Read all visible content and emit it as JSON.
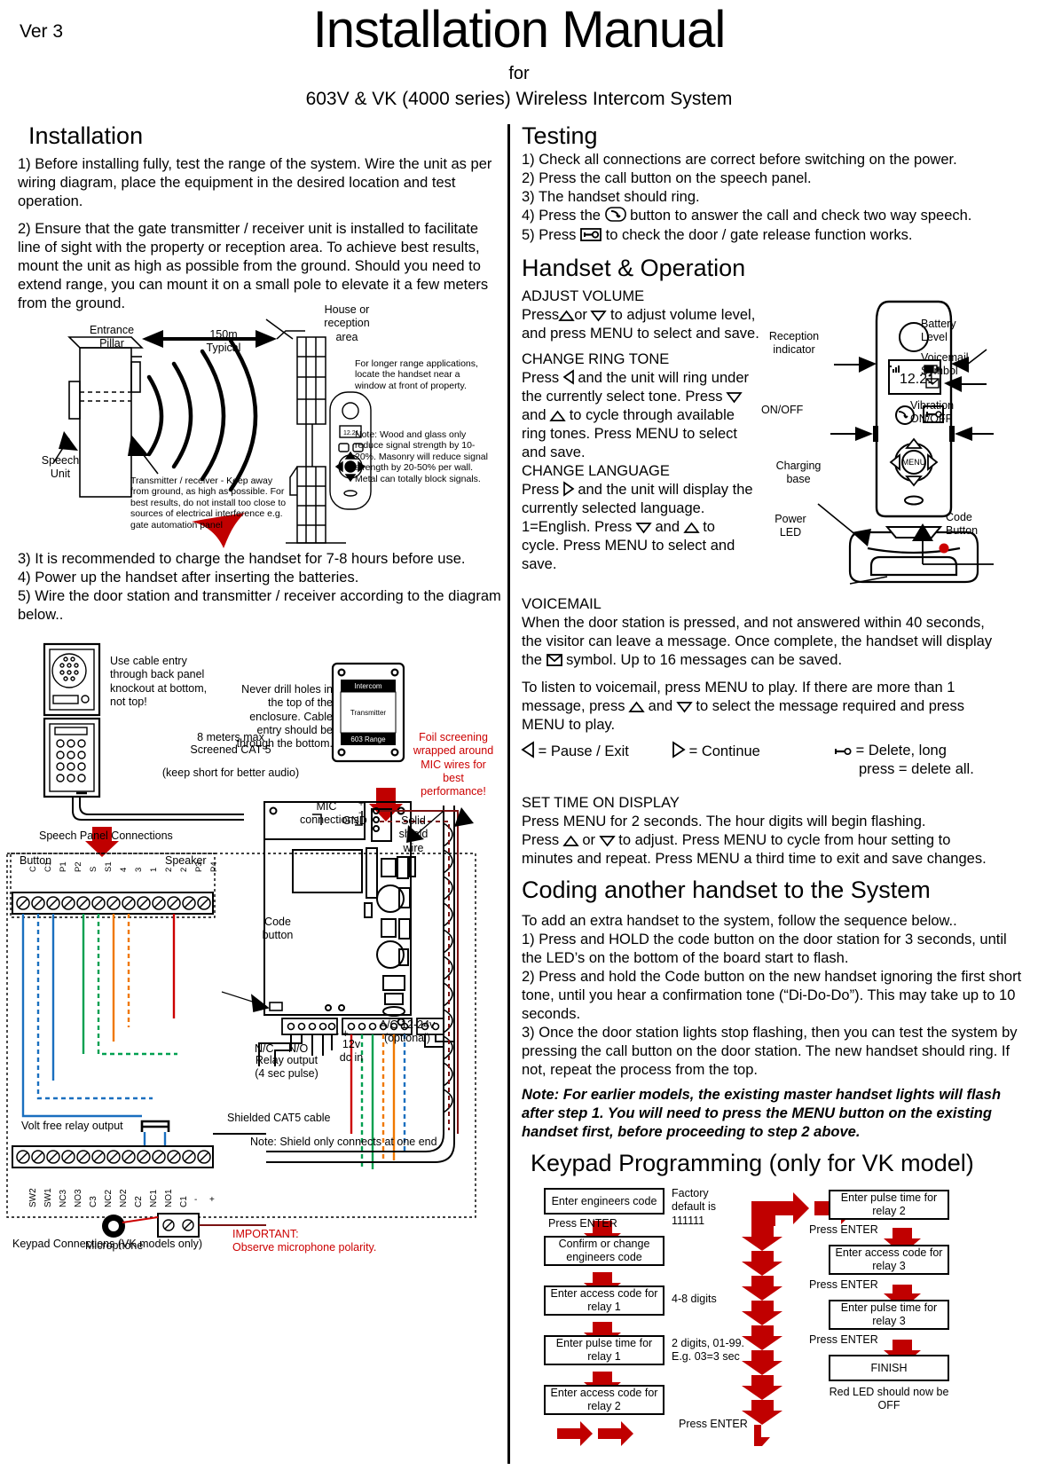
{
  "header": {
    "version": "Ver 3",
    "title": "Installation Manual",
    "for": "for",
    "subtitle": "603V & VK (4000 series) Wireless Intercom System"
  },
  "left": {
    "heading": "Installation",
    "step1": "1) Before installing fully, test the range of the system. Wire the unit as per wiring diagram, place the equipment in the desired location and test operation.",
    "step2": "2) Ensure that the gate transmitter / receiver unit is installed to facilitate line of sight with the property or reception area. To achieve best results, mount the unit as high as possible from the ground. Should you need to extend range, you can mount it on a small pole to elevate it a few meters from the ground.",
    "step3": "3) It is recommended to charge the handset for 7-8 hours before use.",
    "step4": "4) Power up the handset after inserting the batteries.",
    "step5": "5) Wire the door station and transmitter / receiver according to the diagram below..",
    "range_diagram": {
      "distance": "150m",
      "distance_sub": "Typical",
      "entrance_pillar": "Entrance\nPillar",
      "speech_unit": "Speech\nUnit",
      "house": "House or\nreception\narea",
      "transmitter_note": "Transmitter / receiver - Keep away from ground, as high as possible. For best results, do not install too close to sources of electrical interference e.g. gate automation panel",
      "longer_range": "For longer range applications, locate the handset near a window at front of property.",
      "material_note": "Note: Wood and glass only reduce signal strength by 10-20%. Masonry will reduce signal strength by 20-50% per wall. Metal can totally block signals."
    },
    "wiring": {
      "cable_entry": "Use cable entry through back panel knockout at bottom, not top!",
      "never_drill": "Never drill holes in the top of the enclosure. Cable entry should be through the bottom.",
      "cat5_max": "8 meters max",
      "cat5_type": "Screened CAT 5",
      "keep_short": "(keep short for better audio)",
      "foil_note": "Foil screening wrapped around MIC wires for best performance!",
      "enclosure_top": "Intercom",
      "enclosure_mid": "Transmitter",
      "enclosure_bottom": "603 Range",
      "mic_connections": "MIC\nconnections",
      "mic_plus": "+",
      "mic_minus": "-",
      "mic_gnd": "GND",
      "solid_shield": "Solid\nshield\nwire",
      "code_button": "Code\nbutton",
      "nc_label": "N/C",
      "no_label": "N/O",
      "relay_output": "Relay output\n(4 sec pulse)",
      "dc_in": "12v\ndc in",
      "dc_signs": "- +",
      "ac_optional": "A/C 12-24v\n(optional)",
      "shielded_cat5": "Shielded CAT5 cable",
      "shield_note": "Note: Shield only connects at one end",
      "speech_panel_connections": "Speech Panel Connections",
      "button_label": "Button",
      "speaker_label": "Speaker",
      "top_terminals": [
        "C",
        "C1",
        "P1",
        "P2",
        "S",
        "S1",
        "4",
        "3",
        "1",
        "2",
        "2",
        "P3",
        "P4"
      ],
      "volt_free": "Volt free relay output",
      "bottom_terminals": [
        "SW2",
        "SW1",
        "NC3",
        "NO3",
        "C3",
        "NC2",
        "NO2",
        "C2",
        "NC1",
        "NO1",
        "C1",
        "-",
        "+"
      ],
      "keypad_connections": "Keypad Connections (VK models only)",
      "microphone": "Microphone",
      "important": "IMPORTANT:\nObserve microphone polarity."
    }
  },
  "right": {
    "testing": {
      "heading": "Testing",
      "steps": [
        "1) Check all connections are correct before switching on the power.",
        "2) Press the call button on the speech panel.",
        "3) The handset should ring.",
        "4) Press the",
        "5) Press"
      ],
      "step4_rest": "button to answer the call and check two way speech.",
      "step5_rest": "to check the door / gate release function works."
    },
    "handset": {
      "heading": "Handset & Operation",
      "adjust_volume_title": "ADJUST VOLUME",
      "adjust_volume_a": "Press",
      "adjust_volume_b": "or",
      "adjust_volume_c": "to adjust volume level,",
      "adjust_volume_d": "and press MENU to select and save.",
      "ring_tone_title": "CHANGE RING TONE",
      "ring_tone_a": "Press",
      "ring_tone_b": "and the unit will ring under",
      "ring_tone_c": "the currently select tone. Press",
      "ring_tone_d": "and",
      "ring_tone_e": "to cycle through available",
      "ring_tone_f": "ring tones. Press MENU to select",
      "ring_tone_g": "and save.",
      "language_title": "CHANGE LANGUAGE",
      "language_a": "Press",
      "language_b": "and the unit will display the",
      "language_c": "currently selected language.",
      "language_d": "1=English. Press",
      "language_e": "and",
      "language_f": "to",
      "language_g": "cycle. Press MENU to select and",
      "language_h": "save.",
      "diagram": {
        "reception_indicator": "Reception\nindicator",
        "battery_level": "Battery\nLevel",
        "voicemail_symbol": "Voicemail\nSymbol",
        "on_off": "ON/OFF",
        "vibration": "Vibration\nON/OFF",
        "charging_base": "Charging\nbase",
        "power_led": "Power\nLED",
        "code_button": "Code\nButton",
        "screen_time": "12.21",
        "menu_label": "MENU"
      }
    },
    "voicemail": {
      "title": "VOICEMAIL",
      "p1a": "When the door station is pressed, and not answered within 40 seconds,",
      "p1b": "the visitor can leave a message. Once complete, the handset will display",
      "p1c_pre": "the",
      "p1c_post": "symbol. Up to 16 messages can be saved.",
      "p2a": "To listen to voicemail, press MENU to play. If there are more than 1",
      "p2b_pre": "message, press",
      "p2b_mid": "and",
      "p2b_post": "to select the message required and press",
      "p2c": "MENU to play.",
      "legend_pause": "= Pause / Exit",
      "legend_continue": "= Continue",
      "legend_delete": "= Delete, long",
      "legend_delete2": "press = delete all."
    },
    "settime": {
      "title": "SET TIME ON DISPLAY",
      "l1": "Press MENU for 2 seconds. The hour digits will begin flashing.",
      "l2a": "Press",
      "l2b": "or",
      "l2c": "to adjust. Press MENU to cycle from hour setting to",
      "l3": "minutes and repeat. Press MENU a third time to exit and save changes."
    },
    "coding": {
      "heading": "Coding another handset to the System",
      "intro": "To add an extra handset to the system, follow the sequence below..",
      "step1": "1) Press and HOLD the code button on the door station for 3 seconds, until the LED’s on the bottom of the board start to flash.",
      "step2": "2) Press and hold the Code button on the new handset ignoring the first short tone, until you hear a confirmation tone (“Di-Do-Do”). This may take up to 10 seconds.",
      "step3": "3) Once the door station lights stop flashing, then you can test the system by pressing the call button on the door station. The new handset should ring. If not, repeat the process from the top.",
      "note": "Note: For earlier models, the existing master handset lights will flash after step 1. You will need to press the MENU button on the existing handset first, before proceeding to step 2 above."
    },
    "keypad": {
      "heading": "Keypad Programming (only for VK model)",
      "left_boxes": [
        "Enter engineers code",
        "Confirm or change engineers code",
        "Enter access code for relay 1",
        "Enter pulse time for relay 1",
        "Enter access code for relay 2"
      ],
      "right_boxes": [
        "Enter pulse time for relay 2",
        "Enter access code for relay 3",
        "Enter pulse time for relay 3",
        "FINISH"
      ],
      "annotation_factory": "Factory default is 111111",
      "annotation_digits": "4-8 digits",
      "annotation_pulse": "2 digits, 01-99. E.g. 03=3 sec",
      "press_enter": "Press ENTER",
      "footer": "Red LED should now be OFF"
    }
  }
}
